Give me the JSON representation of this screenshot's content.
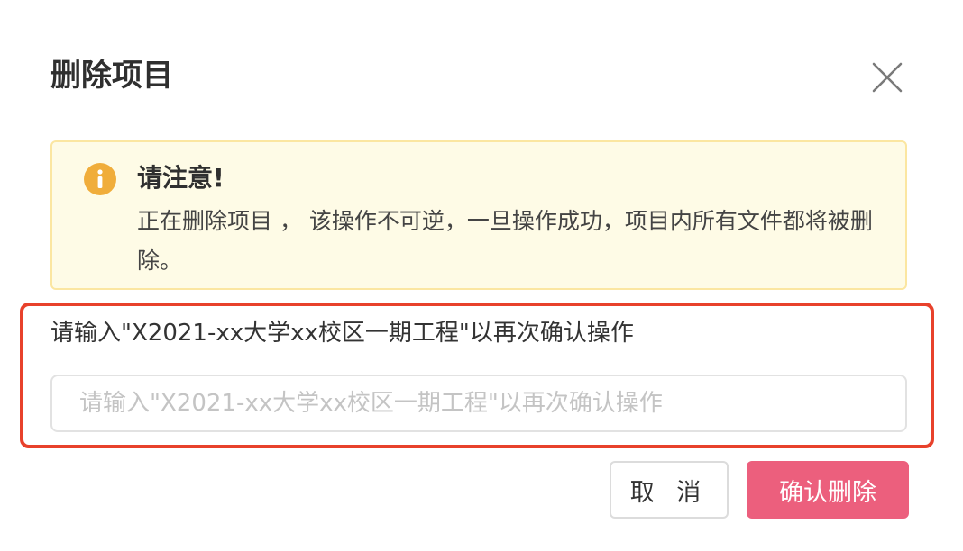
{
  "dialog": {
    "title": "删除项目",
    "close_icon": "close-icon"
  },
  "warning": {
    "icon": "info-icon",
    "heading": "请注意!",
    "message": "正在删除项目 ， 该操作不可逆，一旦操作成功，项目内所有文件都将被删除。"
  },
  "confirm": {
    "label": "请输入\"X2021-xx大学xx校区一期工程\"以再次确认操作",
    "input_value": "",
    "input_placeholder": "请输入\"X2021-xx大学xx校区一期工程\"以再次确认操作"
  },
  "buttons": {
    "cancel_label": "取 消",
    "delete_label": "确认删除"
  },
  "colors": {
    "warning_bg": "#fefbe6",
    "warning_border": "#fbe6a1",
    "info_icon": "#f0ad3b",
    "highlight_border": "#e8412b",
    "delete_button": "#ec5f7d"
  }
}
